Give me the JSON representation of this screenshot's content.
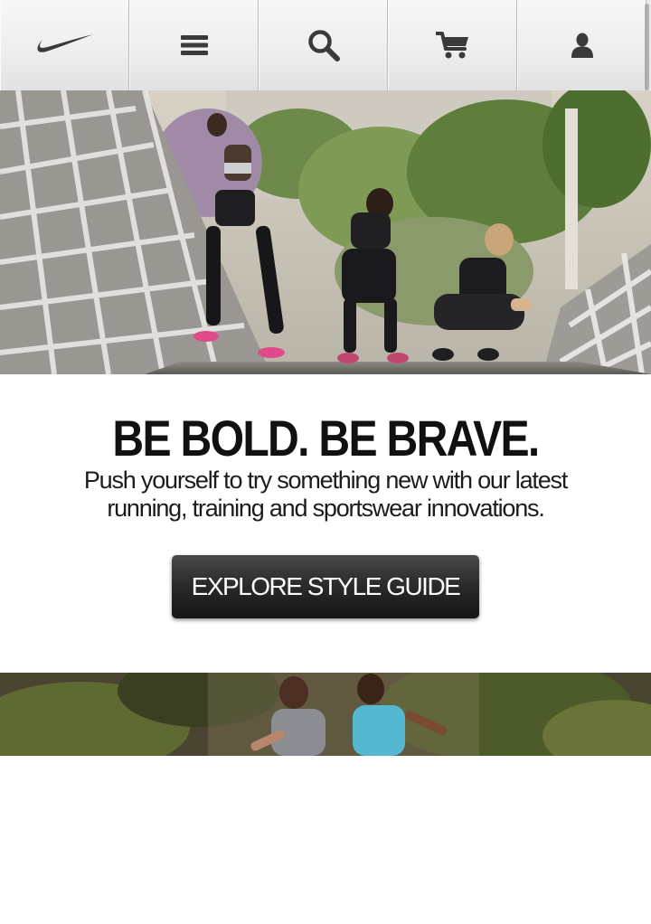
{
  "nav": {
    "items": [
      {
        "id": "home",
        "icon": "swoosh-logo-icon"
      },
      {
        "id": "menu",
        "icon": "hamburger-menu-icon"
      },
      {
        "id": "search",
        "icon": "search-icon"
      },
      {
        "id": "cart",
        "icon": "cart-icon"
      },
      {
        "id": "account",
        "icon": "user-icon"
      }
    ],
    "icon_color": "#3a3a3a"
  },
  "hero": {
    "image": "three-female-runners-resting-on-rope-bridge"
  },
  "promo": {
    "headline": "BE BOLD. BE BRAVE.",
    "subcopy_line1": "Push yourself to try something new with our latest",
    "subcopy_line2": "running, training and sportswear innovations.",
    "cta_label": "EXPLORE STYLE GUIDE"
  },
  "banner2": {
    "image": "two-girls-running-outdoors"
  },
  "colors": {
    "cta_bg": "#2c2c2c",
    "text": "#111111",
    "nav_bg": "#eeeeef"
  }
}
